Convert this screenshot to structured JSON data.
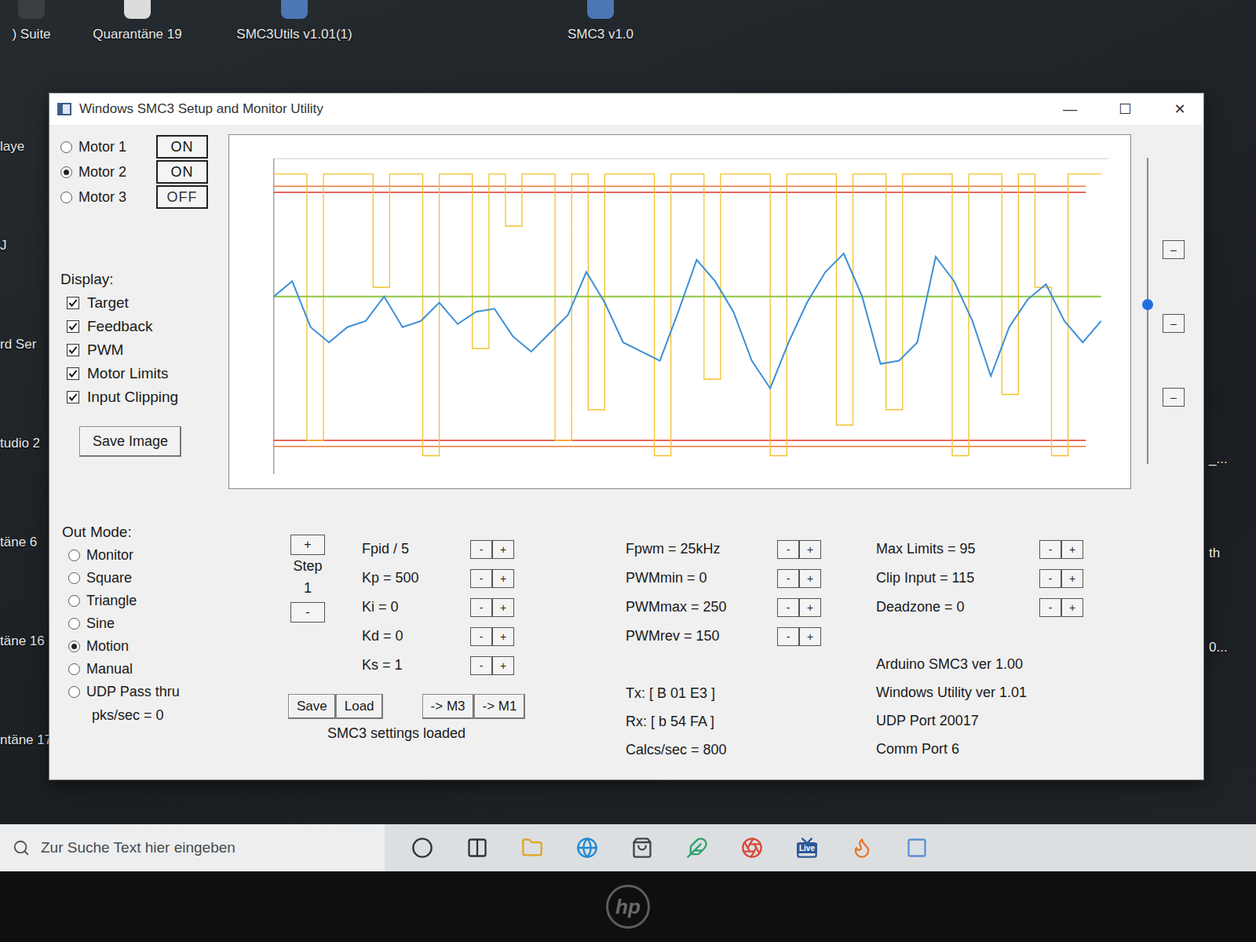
{
  "desktop": {
    "top_icons": [
      ") Suite",
      "Quarantäne 19",
      "SMC3Utils v1.01(1)",
      "SMC3 v1.0"
    ],
    "left_labels": [
      "laye",
      "J",
      "rd Ser",
      "tudio 2",
      "täne 6",
      "täne 16",
      "ntäne 17"
    ],
    "right_labels": [
      "_...",
      "th",
      "0..."
    ]
  },
  "window": {
    "title": "Windows SMC3 Setup and Monitor Utility",
    "controls": [
      "—",
      "☐",
      "✕"
    ]
  },
  "motors": [
    {
      "label": "Motor 1",
      "selected": false,
      "toggle": "ON",
      "on": true
    },
    {
      "label": "Motor 2",
      "selected": true,
      "toggle": "ON",
      "on": true
    },
    {
      "label": "Motor 3",
      "selected": false,
      "toggle": "OFF",
      "on": false
    }
  ],
  "display": {
    "title": "Display:",
    "items": [
      {
        "label": "Target",
        "checked": true,
        "color": "#8cc63f",
        "kind": "line",
        "values": [
          57,
          57,
          57,
          57,
          57,
          57,
          57,
          57
        ]
      },
      {
        "label": "Feedback",
        "checked": true,
        "color": "#3d8fd6",
        "kind": "line",
        "values": [
          57,
          62,
          47,
          42,
          47,
          49,
          57,
          47,
          49,
          55,
          48,
          52,
          53,
          44,
          39,
          45,
          51,
          65,
          55,
          42,
          39,
          36,
          52,
          69,
          62,
          52,
          36,
          27,
          42,
          55,
          65,
          71,
          57,
          35,
          36,
          42,
          70,
          62,
          49,
          31,
          47,
          56,
          61,
          49,
          42,
          49
        ]
      },
      {
        "label": "PWM",
        "checked": true,
        "color": "#f2c12e",
        "kind": "step",
        "values": [
          97,
          97,
          10,
          97,
          97,
          97,
          60,
          97,
          97,
          5,
          97,
          97,
          40,
          97,
          80,
          97,
          97,
          10,
          97,
          20,
          97,
          97,
          97,
          5,
          97,
          97,
          30,
          97,
          97,
          97,
          5,
          97,
          97,
          97,
          15,
          97,
          97,
          20,
          97,
          97,
          97,
          5,
          97,
          97,
          25,
          97,
          60,
          5,
          97,
          97
        ]
      },
      {
        "label": "Motor Limits",
        "checked": true,
        "color": "#d9342b",
        "kind": "hlines",
        "values": [
          91,
          10
        ]
      },
      {
        "label": "Input Clipping",
        "checked": true,
        "color": "#ee7a3a",
        "kind": "hlines",
        "values": [
          93,
          8
        ]
      }
    ]
  },
  "save_image": "Save Image",
  "slider": {
    "level": 0.52,
    "buttons": [
      "–",
      "–",
      "–"
    ]
  },
  "out_mode": {
    "title": "Out Mode:",
    "options": [
      {
        "label": "Monitor",
        "selected": false
      },
      {
        "label": "Square",
        "selected": false
      },
      {
        "label": "Triangle",
        "selected": false
      },
      {
        "label": "Sine",
        "selected": false
      },
      {
        "label": "Motion",
        "selected": true
      },
      {
        "label": "Manual",
        "selected": false
      },
      {
        "label": "UDP Pass thru",
        "selected": false
      }
    ],
    "rate": "pks/sec = 0"
  },
  "step": {
    "plus": "+",
    "label": "Step",
    "value": "1",
    "minus": "-"
  },
  "adjust": {
    "minus": "-",
    "plus": "+"
  },
  "pid": [
    "Fpid / 5",
    "Kp = 500",
    "Ki = 0",
    "Kd = 0",
    "Ks = 1"
  ],
  "pwm": [
    "Fpwm = 25kHz",
    "PWMmin = 0",
    "PWMmax = 250",
    "PWMrev = 150"
  ],
  "limits": [
    "Max Limits = 95",
    "Clip Input = 115",
    "Deadzone = 0"
  ],
  "actions": {
    "file_buttons": [
      "Save",
      "Load"
    ],
    "copy_buttons": [
      "-> M3",
      "-> M1"
    ],
    "status": "SMC3 settings loaded"
  },
  "comms": [
    "Tx: [ B 01 E3 ]",
    "Rx: [ b 54 FA ]",
    "Calcs/sec = 800"
  ],
  "versions": [
    "Arduino SMC3 ver 1.00",
    "Windows Utility ver 1.01",
    "UDP Port 20017",
    "Comm Port 6"
  ],
  "taskbar": {
    "search_placeholder": "Zur Suche Text hier eingeben",
    "live_label": "Live"
  },
  "bezel_logo": "hp"
}
